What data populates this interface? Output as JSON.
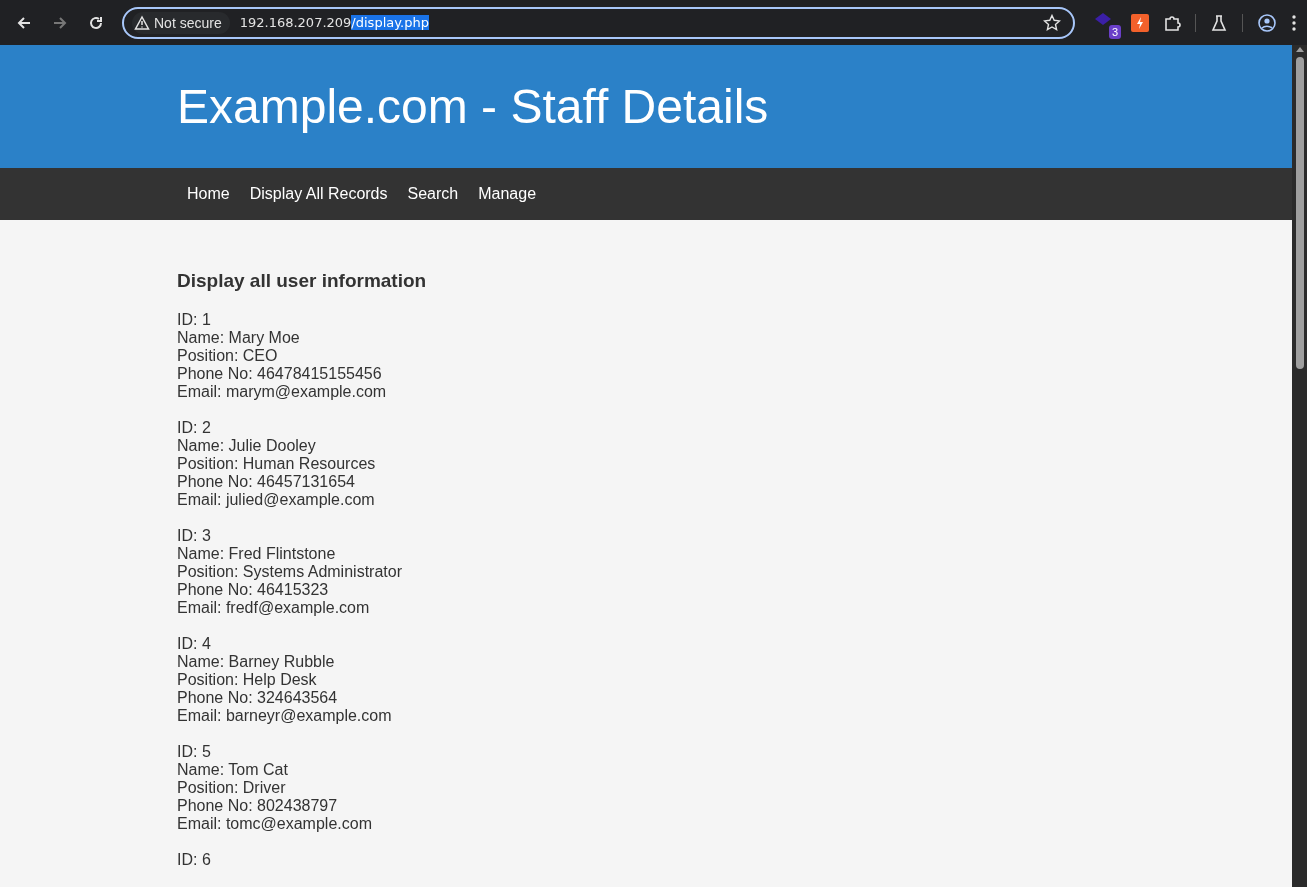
{
  "browser": {
    "security_label": "Not secure",
    "url_host": "192.168.207.209",
    "url_path": "/display.php",
    "extension_badge": "3"
  },
  "header": {
    "title": "Example.com - Staff Details"
  },
  "nav": [
    "Home",
    "Display All Records",
    "Search",
    "Manage"
  ],
  "content": {
    "heading": "Display all user information",
    "records": [
      {
        "lines": [
          "ID: 1",
          "Name: Mary Moe",
          "Position: CEO",
          "Phone No: 46478415155456",
          "Email: marym@example.com"
        ]
      },
      {
        "lines": [
          "ID: 2",
          "Name: Julie Dooley",
          "Position: Human Resources",
          "Phone No: 46457131654",
          "Email: julied@example.com"
        ]
      },
      {
        "lines": [
          "ID: 3",
          "Name: Fred Flintstone",
          "Position: Systems Administrator",
          "Phone No: 46415323",
          "Email: fredf@example.com"
        ]
      },
      {
        "lines": [
          "ID: 4",
          "Name: Barney Rubble",
          "Position: Help Desk",
          "Phone No: 324643564",
          "Email: barneyr@example.com"
        ]
      },
      {
        "lines": [
          "ID: 5",
          "Name: Tom Cat",
          "Position: Driver",
          "Phone No: 802438797",
          "Email: tomc@example.com"
        ]
      },
      {
        "lines": [
          "ID: 6"
        ]
      }
    ]
  }
}
